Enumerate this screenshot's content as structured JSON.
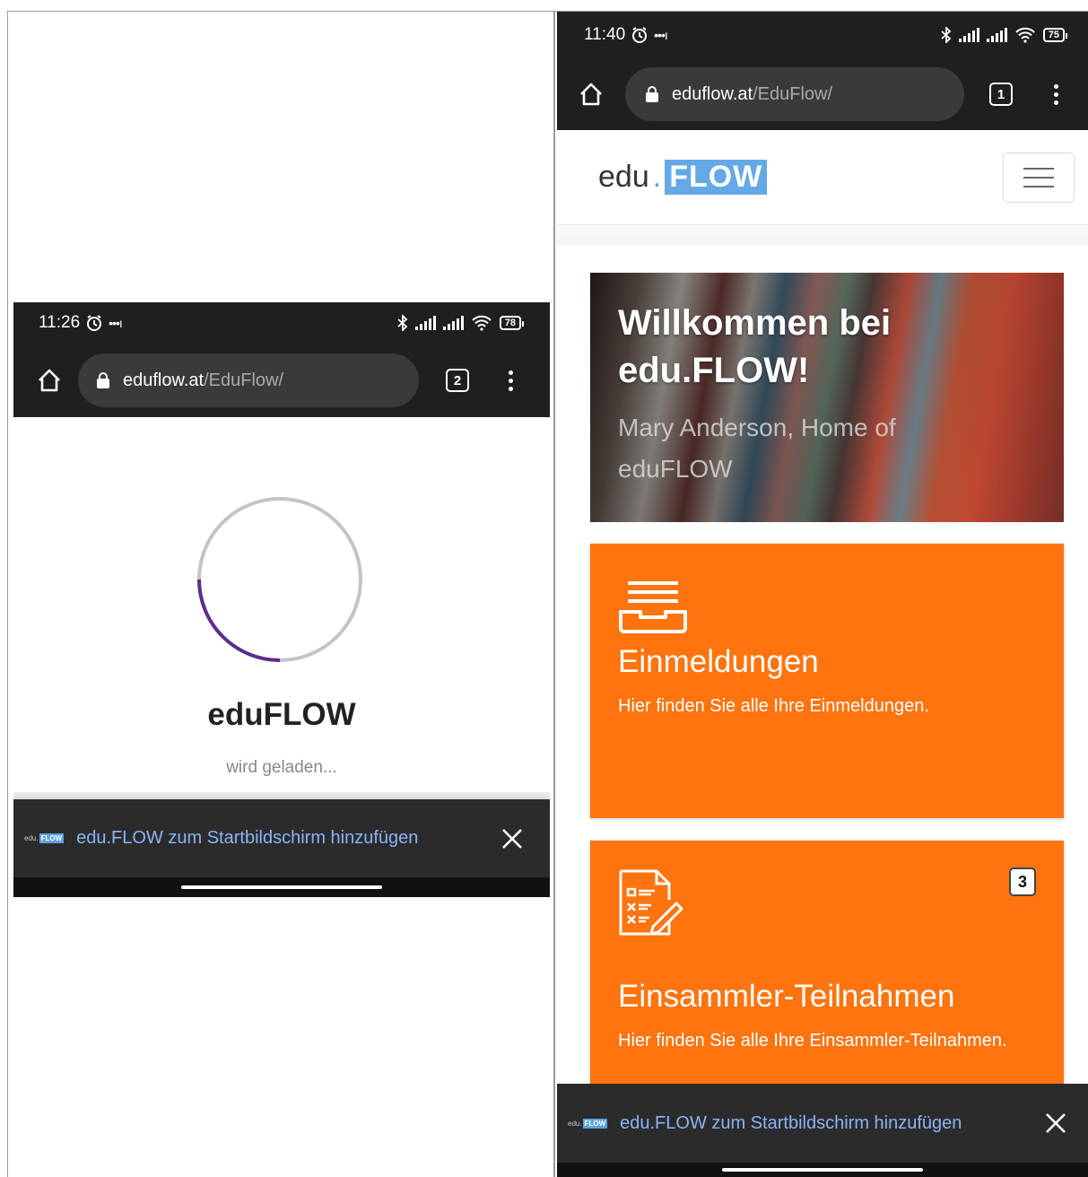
{
  "left": {
    "status": {
      "time": "11:26",
      "battery": "78"
    },
    "url": {
      "host": "eduflow.at",
      "path": "/EduFlow/"
    },
    "tab_count": "2",
    "loader": {
      "app_name": "eduFLOW",
      "status_text": "wird geladen..."
    },
    "install": {
      "mini_logo_edu": "edu.",
      "mini_logo_flow": "FLOW",
      "text": "edu.FLOW zum Startbildschirm hinzufügen"
    }
  },
  "right": {
    "status": {
      "time": "11:40",
      "battery": "75"
    },
    "url": {
      "host": "eduflow.at",
      "path": "/EduFlow/"
    },
    "tab_count": "1",
    "logo": {
      "edu": "edu",
      "dot": ".",
      "flow": "FLOW"
    },
    "hero": {
      "title_line1": "Willkommen bei",
      "title_line2": "edu.FLOW!",
      "subtitle_line1": "Mary Anderson, Home of",
      "subtitle_line2": "eduFLOW"
    },
    "cards": [
      {
        "title": "Einmeldungen",
        "description": "Hier finden Sie alle Ihre Einmeldungen.",
        "icon": "inbox-tray-icon"
      },
      {
        "title": "Einsammler-Teilnahmen",
        "description": "Hier finden Sie alle Ihre Einsammler-Teilnahmen.",
        "icon": "checklist-edit-icon",
        "badge": "3"
      }
    ],
    "install": {
      "mini_logo_edu": "edu.",
      "mini_logo_flow": "FLOW",
      "text": "edu.FLOW zum Startbildschirm hinzufügen"
    }
  },
  "colors": {
    "card_orange": "#ff740f",
    "accent_blue": "#64a9e6",
    "install_text": "#8ab4f8",
    "spinner_progress": "#5b2d8e"
  },
  "loader_progress": 0.25
}
